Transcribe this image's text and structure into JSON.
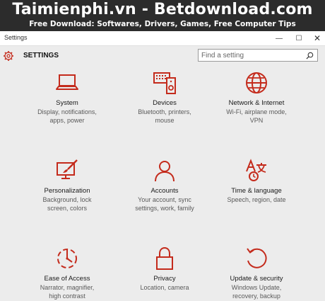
{
  "watermark": {
    "title": "Taimienphi.vn - Betdownload.com",
    "subtitle": "Free Download: Softwares, Drivers, Games, Free Computer Tips"
  },
  "window": {
    "title": "Settings",
    "minimize": "—",
    "maximize": "☐",
    "close": "✕"
  },
  "header": {
    "title": "SETTINGS",
    "search_placeholder": "Find a setting"
  },
  "accent_color": "#c42b1c",
  "tiles": [
    {
      "name": "System",
      "desc": "Display, notifications, apps, power",
      "icon": "laptop-icon"
    },
    {
      "name": "Devices",
      "desc": "Bluetooth, printers, mouse",
      "icon": "devices-icon"
    },
    {
      "name": "Network & Internet",
      "desc": "Wi-Fi, airplane mode, VPN",
      "icon": "globe-icon"
    },
    {
      "name": "Personalization",
      "desc": "Background, lock screen, colors",
      "icon": "paintbrush-icon"
    },
    {
      "name": "Accounts",
      "desc": "Your account, sync settings, work, family",
      "icon": "person-icon"
    },
    {
      "name": "Time & language",
      "desc": "Speech, region, date",
      "icon": "time-language-icon"
    },
    {
      "name": "Ease of Access",
      "desc": "Narrator, magnifier, high contrast",
      "icon": "ease-of-access-icon"
    },
    {
      "name": "Privacy",
      "desc": "Location, camera",
      "icon": "lock-icon"
    },
    {
      "name": "Update & security",
      "desc": "Windows Update, recovery, backup",
      "icon": "refresh-icon"
    }
  ]
}
